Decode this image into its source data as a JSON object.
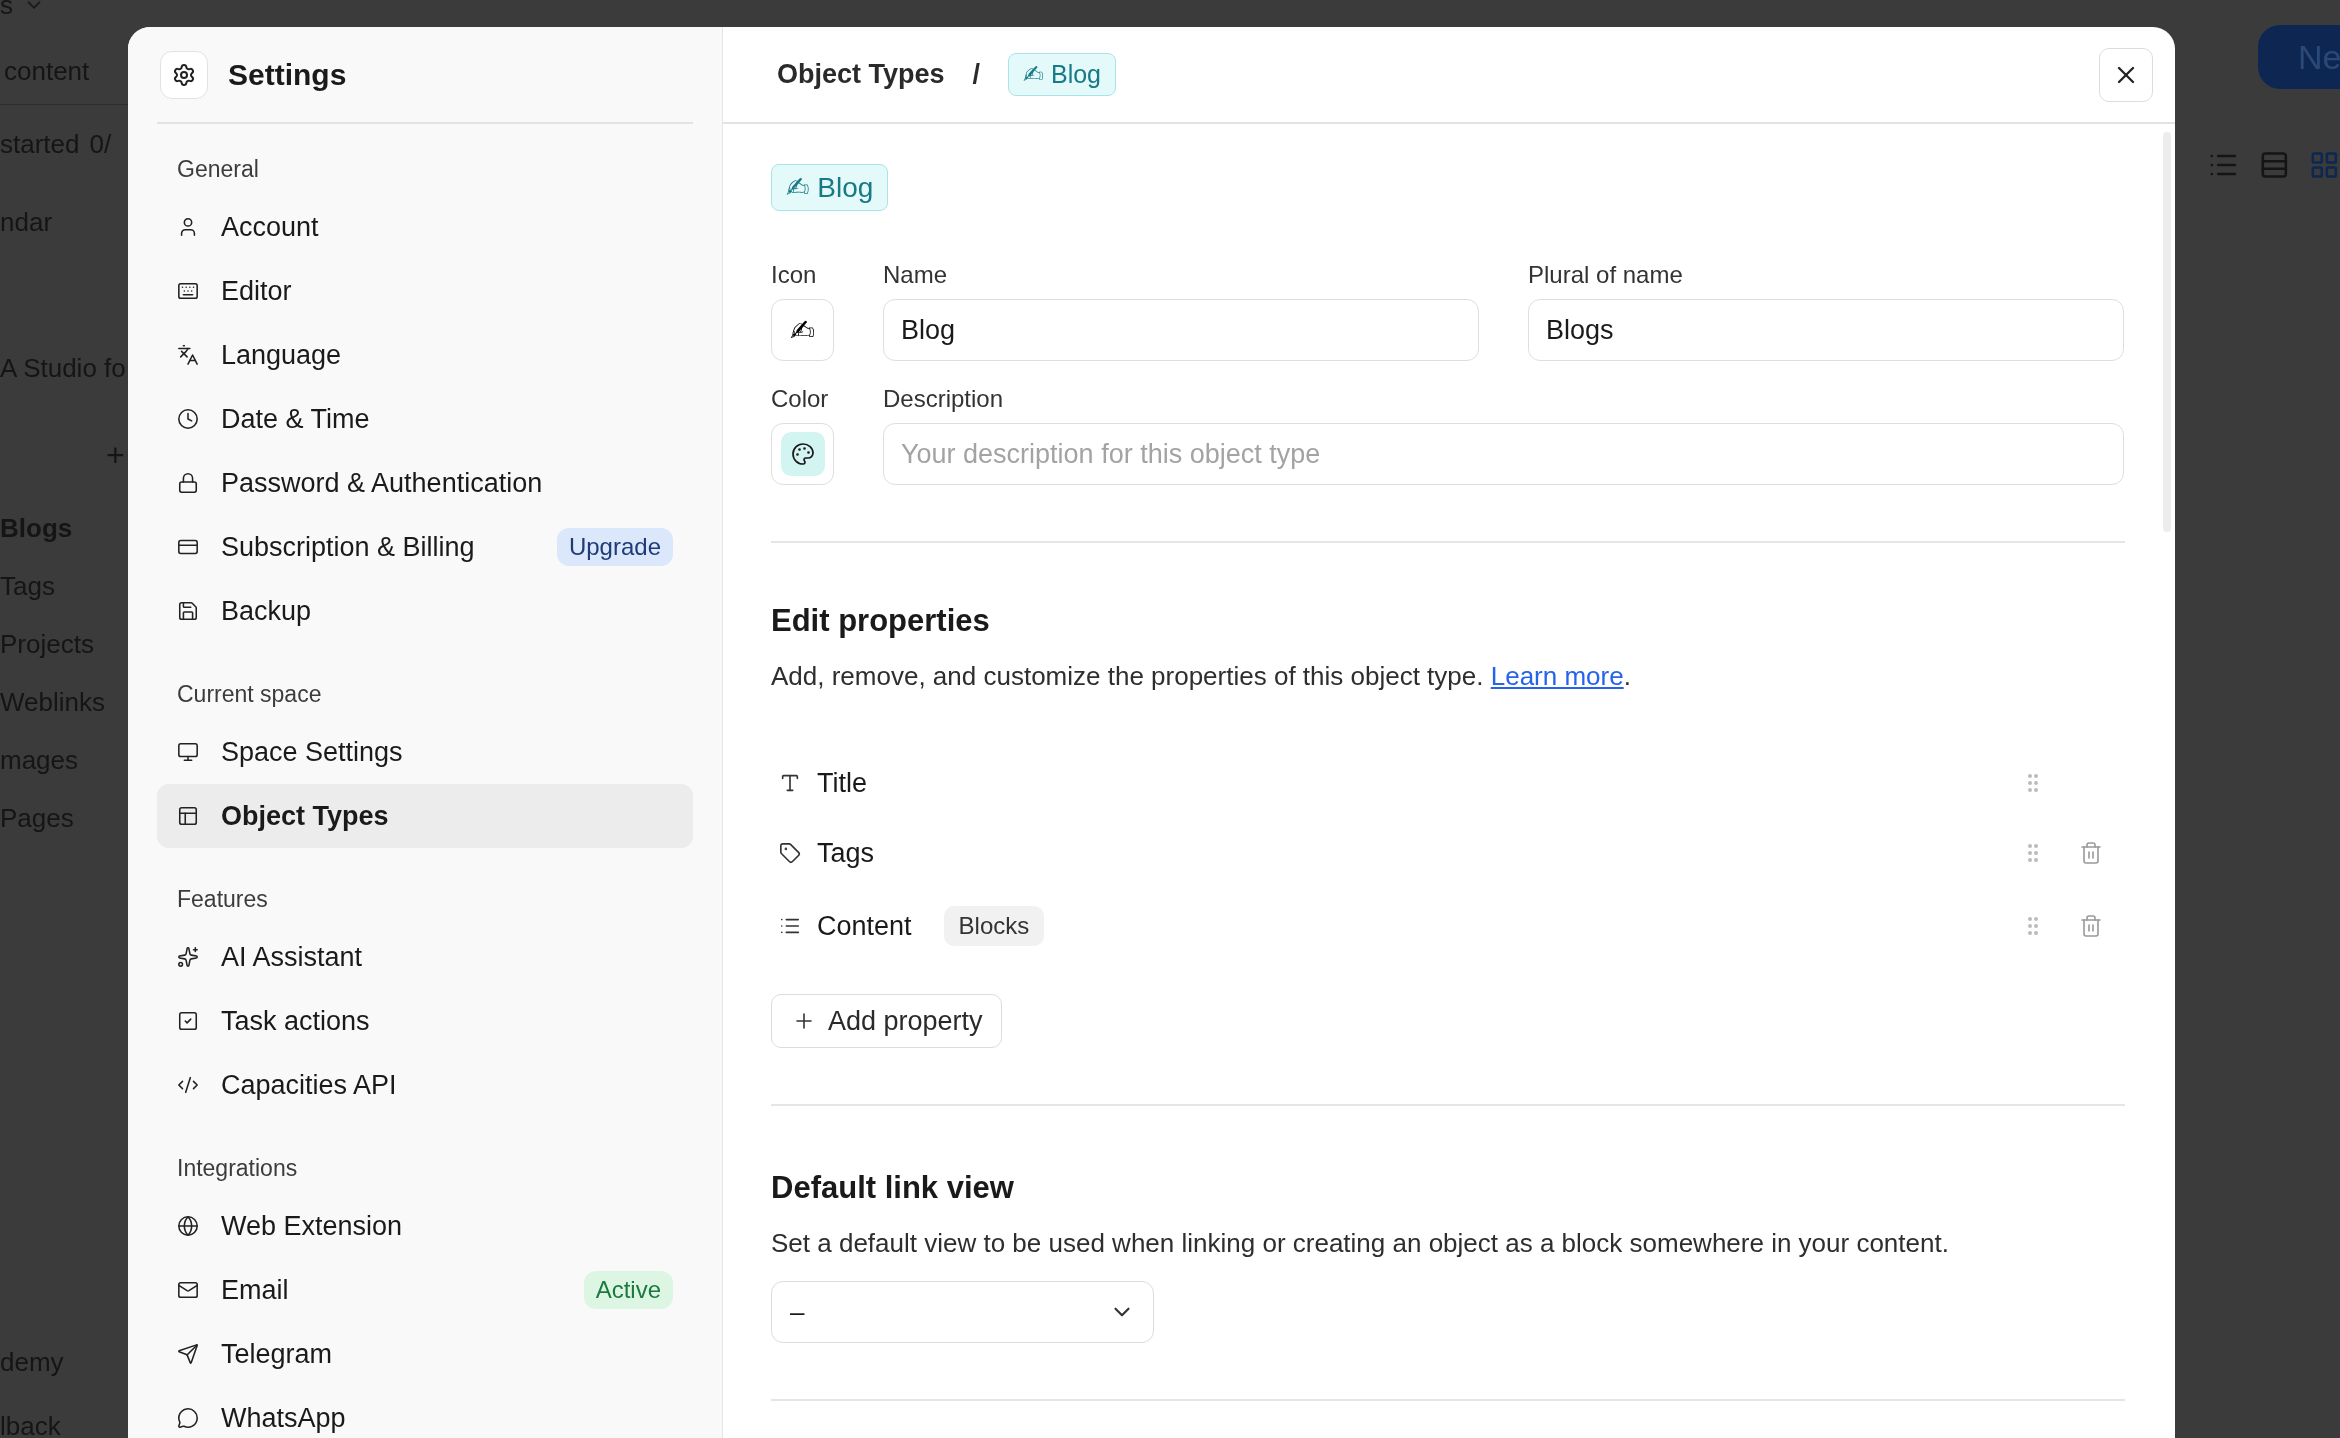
{
  "background": {
    "top_label": "s",
    "search_text": "content",
    "progress_label": "started",
    "progress_count": "0/",
    "items": [
      {
        "label": "ndar",
        "bold": false
      },
      {
        "label": "A Studio fo",
        "bold": false
      }
    ],
    "add_symbol": "+",
    "types": [
      {
        "label": "Blogs",
        "selected": true
      },
      {
        "label": "Tags",
        "selected": false
      },
      {
        "label": "Projects",
        "selected": false
      },
      {
        "label": "Weblinks",
        "selected": false
      },
      {
        "label": "mages",
        "selected": false
      },
      {
        "label": "Pages",
        "selected": false
      }
    ],
    "bottom_items": [
      "demy",
      "lback"
    ],
    "new_button": "Ne"
  },
  "settings": {
    "title": "Settings",
    "sections": [
      {
        "title": "General",
        "items": [
          {
            "label": "Account",
            "selected": false
          },
          {
            "label": "Editor",
            "selected": false
          },
          {
            "label": "Language",
            "selected": false
          },
          {
            "label": "Date & Time",
            "selected": false
          },
          {
            "label": "Password & Authentication",
            "selected": false
          },
          {
            "label": "Subscription & Billing",
            "selected": false,
            "badge": {
              "text": "Upgrade",
              "kind": "upgrade"
            }
          },
          {
            "label": "Backup",
            "selected": false
          }
        ]
      },
      {
        "title": "Current space",
        "items": [
          {
            "label": "Space Settings",
            "selected": false
          },
          {
            "label": "Object Types",
            "selected": true
          }
        ]
      },
      {
        "title": "Features",
        "items": [
          {
            "label": "AI Assistant",
            "selected": false
          },
          {
            "label": "Task actions",
            "selected": false
          },
          {
            "label": "Capacities API",
            "selected": false
          }
        ]
      },
      {
        "title": "Integrations",
        "items": [
          {
            "label": "Web Extension",
            "selected": false
          },
          {
            "label": "Email",
            "selected": false,
            "badge": {
              "text": "Active",
              "kind": "active"
            }
          },
          {
            "label": "Telegram",
            "selected": false
          },
          {
            "label": "WhatsApp",
            "selected": false
          }
        ]
      }
    ]
  },
  "detail": {
    "breadcrumb": {
      "parent": "Object Types",
      "separator": "/",
      "current": "✍ Blog"
    },
    "type_chip": "✍ Blog",
    "fields": {
      "icon_label": "Icon",
      "icon_value": "✍",
      "name_label": "Name",
      "name_value": "Blog",
      "plural_label": "Plural of name",
      "plural_value": "Blogs",
      "color_label": "Color",
      "color": "#d3f5f2",
      "description_label": "Description",
      "description_placeholder": "Your description for this object type"
    },
    "properties_section": {
      "title": "Edit properties",
      "text": "Add, remove, and customize the properties of this object type.",
      "link": "Learn more",
      "text_end": ".",
      "properties": [
        {
          "label": "Title",
          "deletable": false
        },
        {
          "label": "Tags",
          "deletable": true
        },
        {
          "label": "Content",
          "tag": "Blocks",
          "deletable": true
        }
      ],
      "add_button": "Add property"
    },
    "link_view": {
      "title": "Default link view",
      "text": "Set a default view to be used when linking or creating an object as a block somewhere in your content.",
      "value": "–"
    }
  }
}
